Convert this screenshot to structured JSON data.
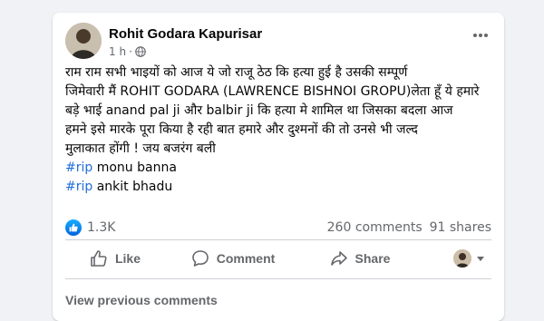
{
  "post": {
    "author": "Rohit Godara Kapurisar",
    "timestamp": "1 h",
    "separator": "·",
    "audience_icon": "globe-icon",
    "text_lines": [
      "राम राम सभी भाइयों को आज ये जो राजू ठेठ कि हत्या हुई है उसकी सम्पूर्ण",
      "जिमेवारी मैं ROHIT GODARA (LAWRENCE BISHNOI GROPU)लेता हूँ  ये हमारे",
      "बड़े भाई anand pal ji और balbir ji कि हत्या मे शामिल था जिसका बदला आज",
      "हमने इसे मारके पूरा किया है रही बात हमारे और दुश्मनों की तो उनसे भी जल्द",
      "मुलाकात होंगी ! जय बजरंग बली"
    ],
    "hashtags": [
      {
        "tag": "#rip",
        "text": " monu banna"
      },
      {
        "tag": "#rip",
        "text": " ankit bhadu"
      }
    ]
  },
  "stats": {
    "reaction_count": "1.3K",
    "comments": "260 comments",
    "shares": "91 shares"
  },
  "actions": {
    "like_label": "Like",
    "comment_label": "Comment",
    "share_label": "Share"
  },
  "comments": {
    "view_previous_label": "View previous comments"
  },
  "colors": {
    "background": "#f0f2f5",
    "card": "#ffffff",
    "hashtag": "#216fdb",
    "secondary_text": "#65676b",
    "like_blue": "#1877f2"
  }
}
